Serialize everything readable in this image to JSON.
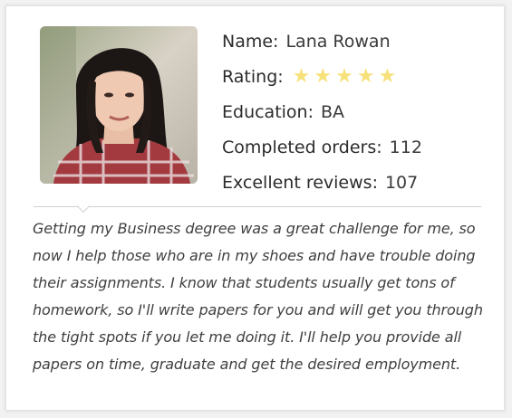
{
  "profile": {
    "name_label": "Name:",
    "name_value": "Lana Rowan",
    "rating_label": "Rating:",
    "rating_stars": 5,
    "rating_max": 5,
    "education_label": "Education:",
    "education_value": "BA",
    "orders_label": "Completed orders:",
    "orders_value": "112",
    "reviews_label": "Excellent reviews:",
    "reviews_value": "107"
  },
  "bio": "Getting my Business degree was a great challenge for me, so now I help those who are in my shoes and have trouble doing their assignments. I know that students usually get tons of homework, so I'll write papers for you and will get you through the tight spots if you let me doing it. I'll help you provide all papers on time, graduate and get the desired employment.",
  "colors": {
    "star": "#f7e17a",
    "text": "#2b2b2b"
  },
  "icons": {
    "star": "star-icon"
  }
}
